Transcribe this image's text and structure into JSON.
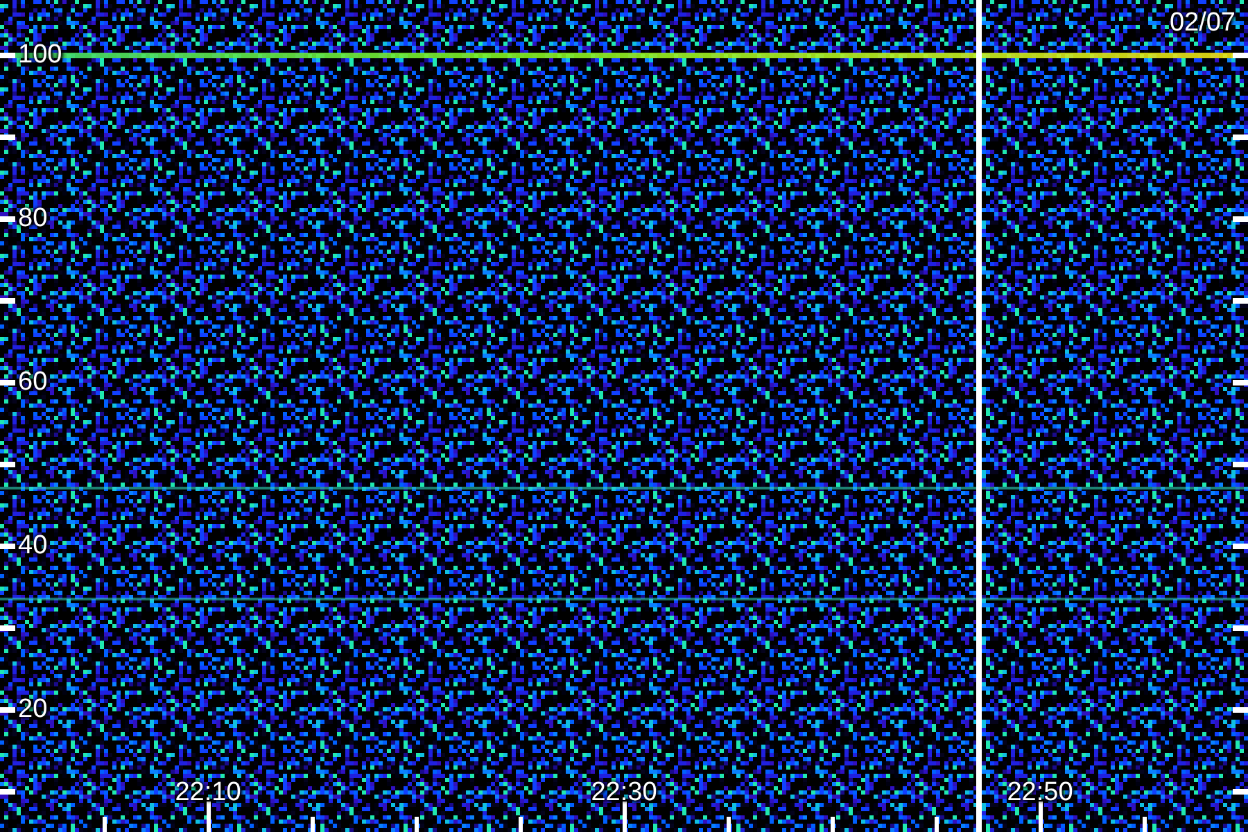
{
  "date": "02/07",
  "y_axis": {
    "labels": [
      "100",
      "80",
      "60",
      "40",
      "20"
    ]
  },
  "x_axis": {
    "labels": [
      "22:10",
      "22:30",
      "22:50"
    ]
  }
}
